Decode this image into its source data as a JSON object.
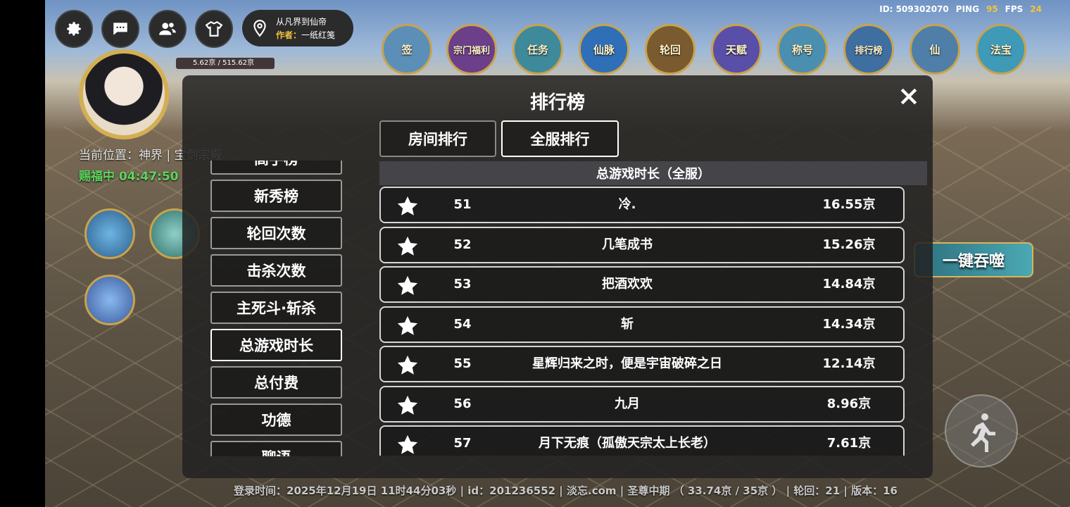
{
  "top_stats": {
    "id_text": "ID: 509302070",
    "ping_label": "PING",
    "ping_value": "95",
    "fps_label": "FPS",
    "fps_value": "24"
  },
  "map_info": {
    "map_name": "从凡界到仙帝",
    "author_label": "作者：",
    "author_name": "一纸红笺"
  },
  "feature_icons": [
    {
      "label": "签"
    },
    {
      "label": "宗门福利"
    },
    {
      "label": "任务"
    },
    {
      "label": "仙脉"
    },
    {
      "label": "轮回"
    },
    {
      "label": "天赋"
    },
    {
      "label": "称号"
    },
    {
      "label": "排行榜"
    },
    {
      "label": "仙"
    },
    {
      "label": "法宝"
    }
  ],
  "player": {
    "hp_text": "5.62京 / 515.62京",
    "location": "当前位置：神界 | 宝剑宗殿",
    "blessing": "赐福中 04:47:50"
  },
  "right_button": "一键吞噬",
  "modal": {
    "title": "排行榜",
    "scope_tabs": [
      "房间排行",
      "全服排行"
    ],
    "active_scope": 1,
    "categories": [
      "高手榜",
      "新秀榜",
      "轮回次数",
      "击杀次数",
      "主死斗·斩杀",
      "总游戏时长",
      "总付费",
      "功德",
      "聊语"
    ],
    "active_category": 5,
    "list_header": "总游戏时长（全服）",
    "rows": [
      {
        "rank": "51",
        "name": "冷.",
        "value": "16.55京"
      },
      {
        "rank": "52",
        "name": "几笔成书",
        "value": "15.26京"
      },
      {
        "rank": "53",
        "name": "把酒欢欢",
        "value": "14.84京"
      },
      {
        "rank": "54",
        "name": "斩",
        "value": "14.34京"
      },
      {
        "rank": "55",
        "name": "星辉归来之时，便是宇宙破碎之日",
        "value": "12.14京"
      },
      {
        "rank": "56",
        "name": "九月",
        "value": "8.96京"
      },
      {
        "rank": "57",
        "name": "月下无痕（孤傲天宗太上长老）",
        "value": "7.61京"
      }
    ]
  },
  "footer": "登录时间：2025年12月19日 11时44分03秒 | id：201236552 | 淡忘.com | 圣尊中期 （ 33.74京 / 35京 ） | 轮回：21 | 版本：16"
}
